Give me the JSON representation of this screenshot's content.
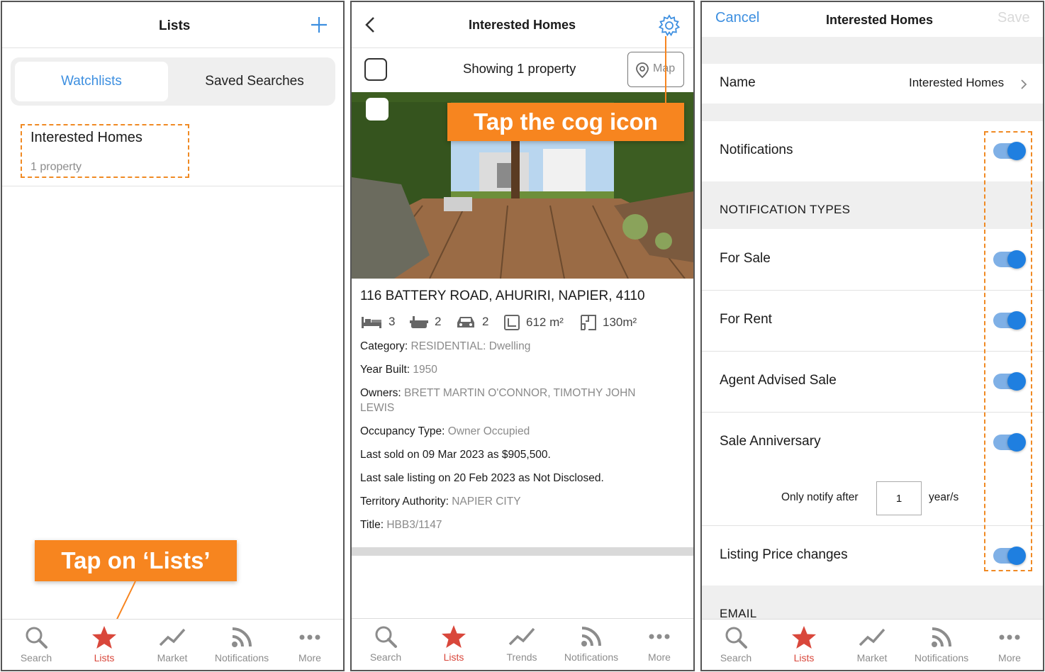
{
  "panel1": {
    "title": "Lists",
    "segments": [
      "Watchlists",
      "Saved Searches"
    ],
    "list_item": {
      "title": "Interested Homes",
      "subtitle": "1 property"
    },
    "callout": "Tap on ‘Lists’",
    "tabs": [
      "Search",
      "Lists",
      "Market",
      "Notifications",
      "More"
    ]
  },
  "panel2": {
    "title": "Interested Homes",
    "showing": "Showing 1 property",
    "map_label": "Map",
    "callout": "Tap the cog icon",
    "address": "116 BATTERY ROAD, AHURIRI, NAPIER, 4110",
    "features": {
      "beds": "3",
      "baths": "2",
      "cars": "2",
      "land": "612 m²",
      "floor": "130m²"
    },
    "rows": [
      {
        "label": "Category:",
        "value": "RESIDENTIAL: Dwelling"
      },
      {
        "label": "Year Built:",
        "value": "1950"
      },
      {
        "label": "Owners:",
        "value": "BRETT MARTIN O'CONNOR, TIMOTHY JOHN",
        "value2": "LEWIS"
      },
      {
        "label": "Occupancy Type:",
        "value": "Owner Occupied"
      },
      {
        "label": "Last sold on 09 Mar 2023 as $905,500.",
        "value": ""
      },
      {
        "label": "Last sale listing on 20 Feb 2023 as Not Disclosed.",
        "value": ""
      },
      {
        "label": "Territory Authority:",
        "value": "NAPIER CITY"
      },
      {
        "label": "Title:",
        "value": "HBB3/1147"
      }
    ],
    "tabs": [
      "Search",
      "Lists",
      "Trends",
      "Notifications",
      "More"
    ]
  },
  "panel3": {
    "cancel": "Cancel",
    "title": "Interested Homes",
    "save": "Save",
    "name_label": "Name",
    "name_value": "Interested Homes",
    "notifications_label": "Notifications",
    "types_header": "NOTIFICATION TYPES",
    "types": [
      "For Sale",
      "For Rent",
      "Agent Advised Sale",
      "Sale Anniversary"
    ],
    "only_notify": "Only notify after",
    "years_value": "1",
    "years_unit": "year/s",
    "listing_price": "Listing Price changes",
    "email_header": "EMAIL",
    "tabs": [
      "Search",
      "Lists",
      "Market",
      "Notifications",
      "More"
    ]
  },
  "colors": {
    "accent": "#3d8fe0",
    "active_tab": "#d9473b",
    "callout": "#f7851f",
    "toggle": "#1f7fe0"
  }
}
